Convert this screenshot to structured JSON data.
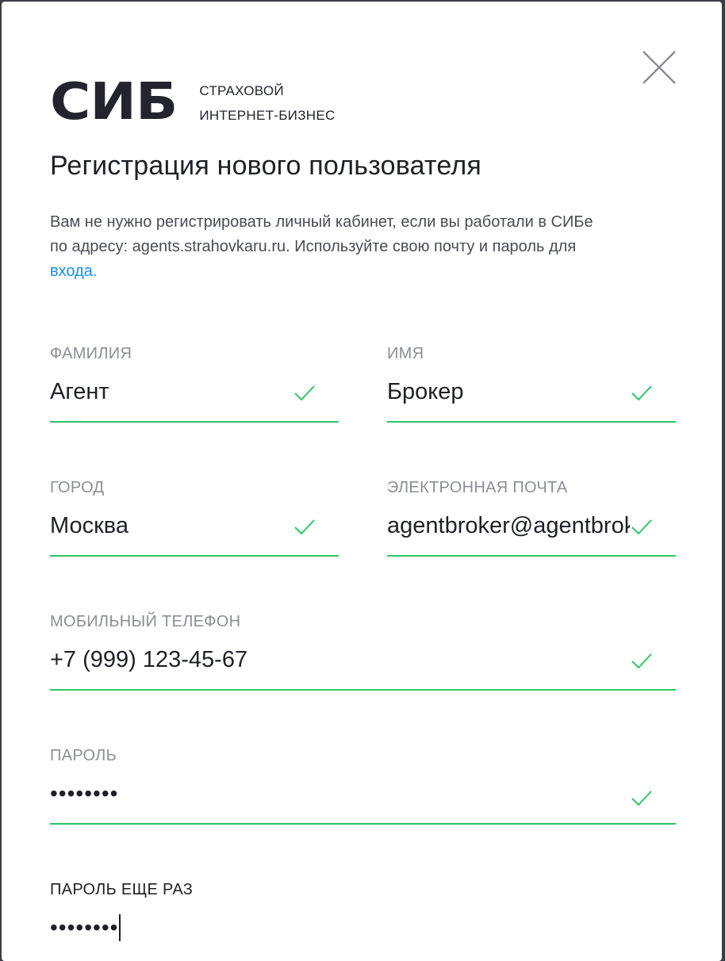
{
  "logo": {
    "mark": "СИБ",
    "line1": "СТРАХОВОЙ",
    "line2": "ИНТЕРНЕТ-БИЗНЕС"
  },
  "title": "Регистрация нового пользователя",
  "notice": {
    "line1": "Вам не нужно регистрировать личный кабинет, если вы работали в СИБе",
    "line2": "по адресу: agents.strahovkaru.ru. Используйте свою почту и пароль для",
    "link": "входа."
  },
  "fields": {
    "last_name": {
      "label": "ФАМИЛИЯ",
      "value": "Агент"
    },
    "first_name": {
      "label": "ИМЯ",
      "value": "Брокер"
    },
    "city": {
      "label": "ГОРОД",
      "value": "Москва"
    },
    "email": {
      "label": "ЭЛЕКТРОННАЯ ПОЧТА",
      "value": "agentbroker@agentbroker"
    },
    "phone": {
      "label": "МОБИЛЬНЫЙ ТЕЛЕФОН",
      "value": "+7 (999) 123-45-67"
    },
    "password": {
      "label": "ПАРОЛЬ",
      "value": "••••••••"
    },
    "password_repeat": {
      "label": "ПАРОЛЬ ЕЩЕ РАЗ",
      "value": "••••••••"
    }
  },
  "colors": {
    "accent_green": "#2ec766",
    "link_blue": "#1a8cf0",
    "label_gray": "#8c8e95",
    "text_dark": "#1f2027"
  },
  "icons": {
    "close": "close-icon",
    "check": "check-icon"
  }
}
